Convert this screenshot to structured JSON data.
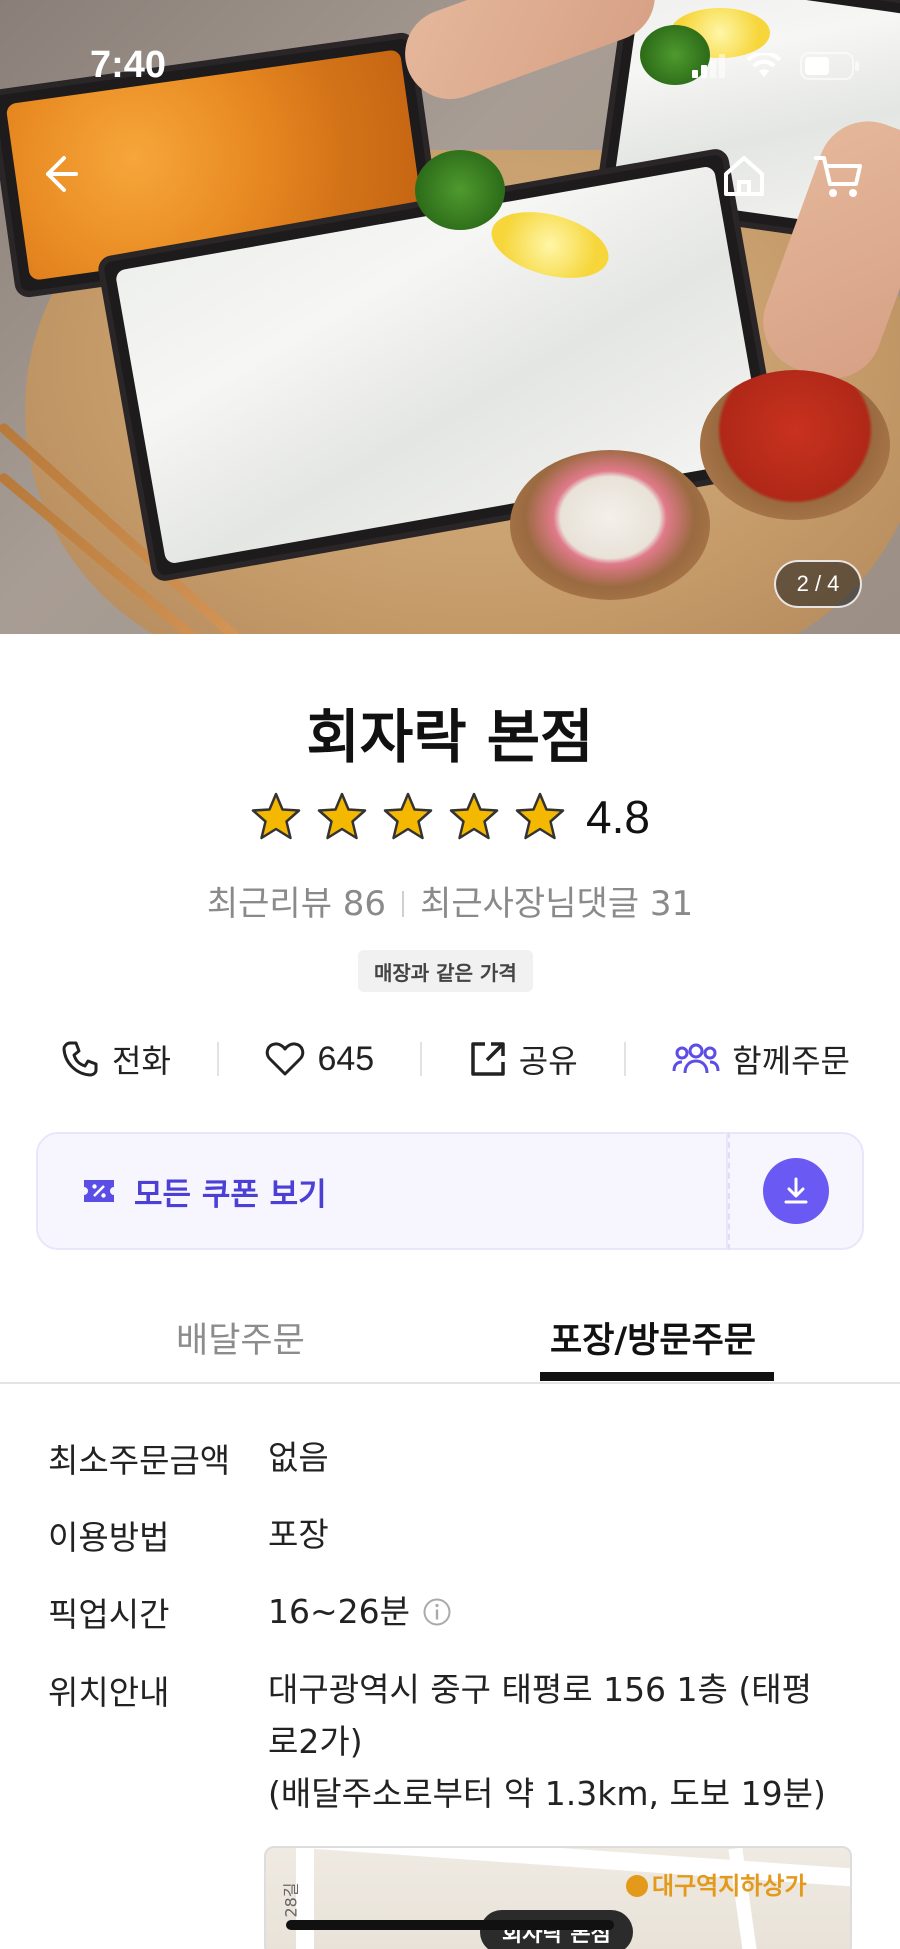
{
  "status_bar": {
    "time": "7:40"
  },
  "hero": {
    "image_counter": "2 / 4"
  },
  "store": {
    "name": "회자락 본점",
    "rating": "4.8",
    "star_count": 5,
    "recent_reviews": "최근리뷰 86",
    "owner_replies": "최근사장님댓글 31",
    "badge": "매장과 같은 가격"
  },
  "actions": {
    "call_label": "전화",
    "likes": "645",
    "share_label": "공유",
    "group_order_label": "함께주문"
  },
  "coupon": {
    "label": "모든 쿠폰 보기"
  },
  "tabs": [
    {
      "label": "배달주문",
      "active": false
    },
    {
      "label": "포장/방문주문",
      "active": true
    }
  ],
  "info": {
    "min_order_label": "최소주문금액",
    "min_order_value": "없음",
    "method_label": "이용방법",
    "method_value": "포장",
    "pickup_label": "픽업시간",
    "pickup_value": "16~26분",
    "location_label": "위치안내",
    "location_line1": "대구광역시 중구 태평로 156 1층 (태평",
    "location_line2": "로2가)",
    "location_line3": "(배달주소로부터 약 1.3km, 도보 19분)"
  },
  "map": {
    "pin_label": "회자락 본점",
    "poi_label": "대구역지하상가",
    "road_label": "28길"
  },
  "colors": {
    "accent_purple": "#6a59f2",
    "coupon_text": "#4c3fd6",
    "star": "#f5b800"
  }
}
